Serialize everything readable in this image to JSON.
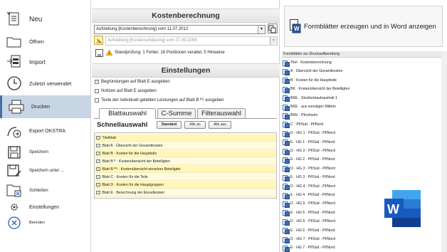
{
  "nav": {
    "items": [
      {
        "label": "Neu",
        "icon": "new-document-icon"
      },
      {
        "label": "Öffnen",
        "icon": "folder-open-icon"
      },
      {
        "label": "Import",
        "icon": "import-icon"
      },
      {
        "label": "Zuletzt verwendet",
        "icon": "clock-icon"
      },
      {
        "label": "Drucken",
        "icon": "printer-icon",
        "active": true
      },
      {
        "label": "Export OKSTRA",
        "icon": "export-icon"
      },
      {
        "label": "Speichern",
        "icon": "save-icon"
      },
      {
        "label": "Speichern unter ...",
        "icon": "save-as-icon"
      },
      {
        "label": "Schließen",
        "icon": "close-document-icon"
      },
      {
        "label": "Einstellungen",
        "icon": "gear-icon"
      },
      {
        "label": "Beenden",
        "icon": "exit-icon"
      }
    ],
    "active_color": "#c8d5e3"
  },
  "kosten": {
    "title": "Kostenberechnung",
    "combo1": "Aufstellung [Kostenberechnung] vom 11.07.2012",
    "combo2": "Aufstellung [Kostenschätzung] vom 27.09.2008",
    "status": "Standprüfung: 1 Fehler, 16 Positionen veraltet, 5 Hinweise"
  },
  "einstellungen": {
    "title": "Einstellungen",
    "opt1": "Begründungen auf Blatt E ausgeben",
    "opt2": "Notizen auf Blatt E ausgeben",
    "opt3": "Texte der individuell geteilten Leistungen auf Blatt B ᴷᴳ ausgeben"
  },
  "tabs": [
    "Blattauswahl",
    "C-Summe",
    "Filterauswahl"
  ],
  "schnell": {
    "title": "Schnellauswahl",
    "btn_standard": "Standard",
    "btn_alle_an": "Alle an",
    "btn_alle_aus": "Alle aus"
  },
  "blatt_list": [
    "Titelblatt",
    "Blatt A · Übersicht der Gesamtkosten",
    "Blatt B · Kosten für die Hauptteile",
    "Blatt B ᴷ · Kostenübersicht der Beteiligten",
    "Blatt B ᴷᴳ · Kostenübersicht einzelner Beteiligter",
    "Blatt C · Kosten für die Teile",
    "Blatt D · Kosten für die Hauptgruppen",
    "Blatt E · Berechnung der Einzelkosten"
  ],
  "right": {
    "gen_label": "Formblätter erzeugen und in Word anzeigen",
    "list_header": "Formblätter zur Druckaufbereitung",
    "forms": [
      "Titel · Kostenberechnung",
      "A · Übersicht der Gesamtkosten",
      "B · Kosten für die Hauptteile",
      "BK · Kostenübersicht der Beteiligten",
      "BKE · Straßenbauhaushalt 1",
      "BKE · aus sonstigen Mitteln",
      "BKE · Pforzheim",
      "C · Pf/Süd - Pf/Nord",
      "D · HG 1 · Pf/Süd - Pf/Nord",
      "E · HG 1 · Pf/Süd - Pf/Nord",
      "D · HG 2 · Pf/Süd - Pf/Nord",
      "E · HG 2 · Pf/Süd - Pf/Nord",
      "D · HG 3 · Pf/Süd - Pf/Nord",
      "E · HG 3 · Pf/Süd - Pf/Nord",
      "D · HG 4 · Pf/Süd - Pf/Nord",
      "E · HG 4 · Pf/Süd - Pf/Nord",
      "D · HG 5 · Pf/Süd - Pf/Nord",
      "E · HG 5 · Pf/Süd - Pf/Nord",
      "D · HG 6 · Pf/Süd - Pf/Nord",
      "E · HG 6 · Pf/Süd - Pf/Nord",
      "D · HG 7 · Pf/Süd - Pf/Nord",
      "E · HG 7 · Pf/Süd - Pf/Nord"
    ],
    "word_color": "#2b579a"
  }
}
